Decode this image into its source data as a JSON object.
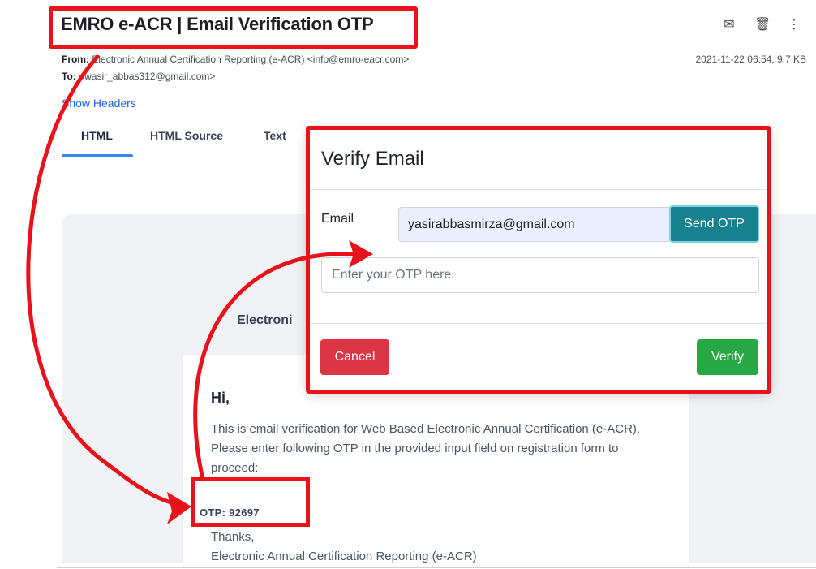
{
  "email": {
    "subject": "EMRO e-ACR | Email Verification OTP",
    "from_label": "From:",
    "from_value": "Electronic Annual Certification Reporting (e-ACR) <info@emro-eacr.com>",
    "to_label": "To:",
    "to_value": "<wasir_abbas312@gmail.com>",
    "date_size": "2021-11-22 06:54, 9.7 KB",
    "show_headers": "Show Headers",
    "actions": [
      "envelope-icon",
      "trash-icon",
      "more-vertical-icon"
    ]
  },
  "tabs": [
    {
      "label": "HTML",
      "active": true
    },
    {
      "label": "HTML Source",
      "active": false
    },
    {
      "label": "Text",
      "active": false
    }
  ],
  "message": {
    "brand_heading": "Electroni",
    "greeting": "Hi,",
    "body": "This is email verification for Web Based Electronic Annual Certification (e-ACR). Please enter following OTP in the provided input field on registration form to proceed:",
    "otp": "OTP: 92697",
    "thanks": "Thanks,",
    "signature": "Electronic Annual Certification Reporting (e-ACR)"
  },
  "modal": {
    "title": "Verify Email",
    "email_label": "Email",
    "email_value": "yasirabbasmirza@gmail.com",
    "send_otp": "Send OTP",
    "otp_placeholder": "Enter your OTP here.",
    "cancel": "Cancel",
    "verify": "Verify"
  },
  "colors": {
    "highlight": "#e8121b",
    "link": "#2563eb",
    "tab_active": "#3b82f6",
    "send_button": "#17818f",
    "cancel_button": "#dc3545",
    "verify_button": "#28a745"
  }
}
